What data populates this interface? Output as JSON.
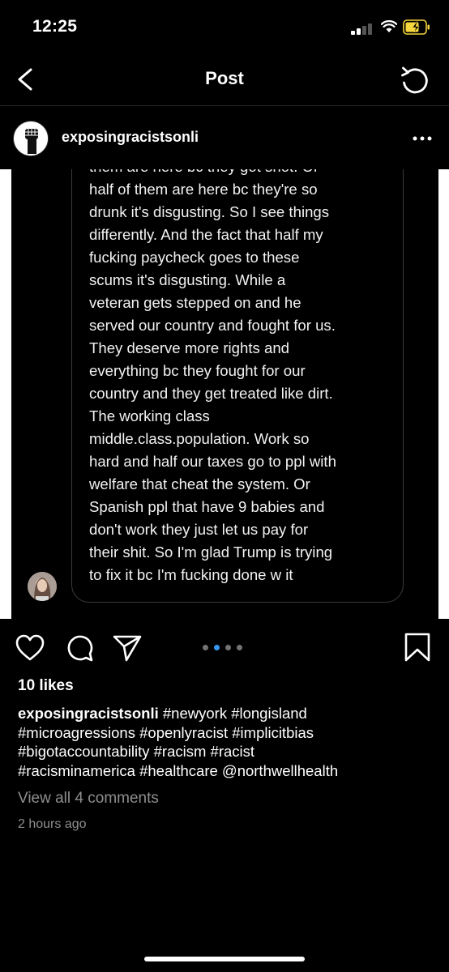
{
  "status_bar": {
    "time": "12:25",
    "battery_color": "#f5d63d"
  },
  "nav": {
    "title": "Post"
  },
  "post": {
    "username": "exposingracistsonli",
    "image_text_lines": [
      "them are here bc they got shot.  Or",
      "half of them are here bc they're so",
      "drunk it's disgusting. So I see things",
      "differently. And the fact that half my",
      "fucking paycheck goes to these",
      "scums it's disgusting. While a",
      "veteran gets stepped on and he",
      "served our country and fought for us.",
      "They deserve more rights and",
      "everything bc they fought for our",
      "country and they get treated like dirt.",
      "The working class",
      "middle.class.population. Work so",
      "hard and half our taxes go to ppl with",
      "welfare that cheat the system. Or",
      "Spanish ppl that have 9 babies and",
      "don't work they just let us pay for",
      "their shit. So I'm glad Trump is trying",
      "to fix it bc I'm fucking done w it"
    ],
    "carousel": {
      "total": 4,
      "active_index": 1,
      "active_color": "#3897f0",
      "inactive_color": "#737373"
    },
    "likes": "10 likes",
    "caption": {
      "username": "exposingracistsonli",
      "line1": "#newyork #longisland",
      "line2": "#microagressions #openlyracist #implicitbias",
      "line3": "#bigotaccountability #racism #racist",
      "line4": "#racisminamerica #healthcare @northwellhealth"
    },
    "comments_link": "View all 4 comments",
    "timestamp": "2 hours ago"
  },
  "icons": {
    "back": "chevron-left-icon",
    "refresh": "refresh-icon",
    "more": "more-horizontal-icon",
    "like": "heart-icon",
    "comment": "comment-icon",
    "share": "send-icon",
    "save": "bookmark-icon"
  }
}
